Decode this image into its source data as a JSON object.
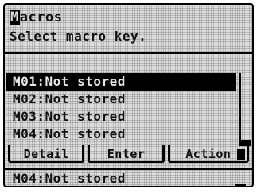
{
  "header": {
    "title_lead": "M",
    "title_rest": "acros",
    "subtitle": "Select macro key."
  },
  "macros": [
    {
      "label": "M01:Not stored",
      "selected": true
    },
    {
      "label": "M02:Not stored",
      "selected": false
    },
    {
      "label": "M03:Not stored",
      "selected": false
    },
    {
      "label": "M04:Not stored",
      "selected": false
    }
  ],
  "softkeys": {
    "detail": "Detail",
    "enter": "Enter",
    "action": "Action"
  },
  "footer": {
    "row_label": "M04:Not stored"
  },
  "colors": {
    "lcd_background": "#dcdcdc",
    "ink": "#000000"
  }
}
